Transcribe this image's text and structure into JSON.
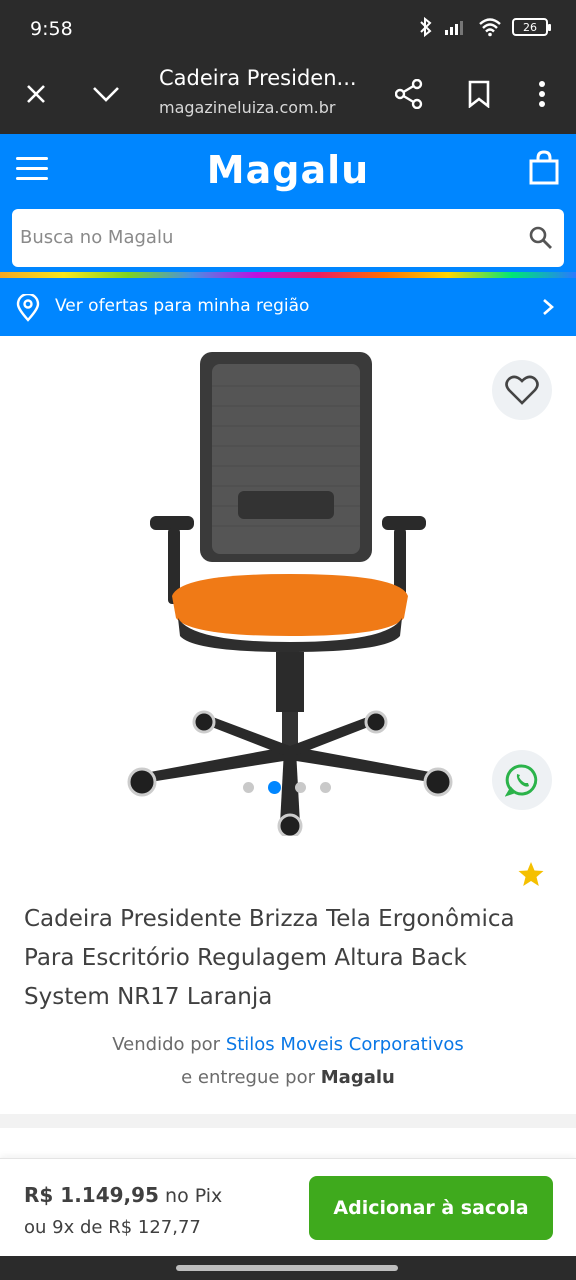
{
  "status_bar": {
    "time": "9:58",
    "battery": "26"
  },
  "browser": {
    "title": "Cadeira Presiden...",
    "url": "magazineluiza.com.br",
    "close_icon": "close-icon",
    "chevron_icon": "chevron-down-icon",
    "share_icon": "share-icon",
    "bookmark_icon": "bookmark-icon",
    "more_icon": "more-vert-icon"
  },
  "header": {
    "logo": "Magalu",
    "menu_icon": "hamburger-icon",
    "bag_icon": "shopping-bag-icon",
    "brand_color": "#0086ff"
  },
  "search": {
    "placeholder": "Busca no Magalu"
  },
  "region": {
    "label": "Ver ofertas para minha região"
  },
  "gallery": {
    "total_images": 4,
    "active_index": 2
  },
  "product": {
    "title": "Cadeira Presidente Brizza Tela Ergonômica Para Escritório Regulagem Altura Back System NR17 Laranja",
    "sold_by_prefix": "Vendido por",
    "seller": "Stilos Moveis Corporativos",
    "delivered_by_prefix": "e entregue por",
    "delivered_by": "Magalu"
  },
  "purchase": {
    "price": "R$ 1.149,95",
    "price_suffix": "no Pix",
    "installments": "ou 9x de R$ 127,77",
    "add_button": "Adicionar à sacola",
    "button_color": "#3faa1d"
  }
}
